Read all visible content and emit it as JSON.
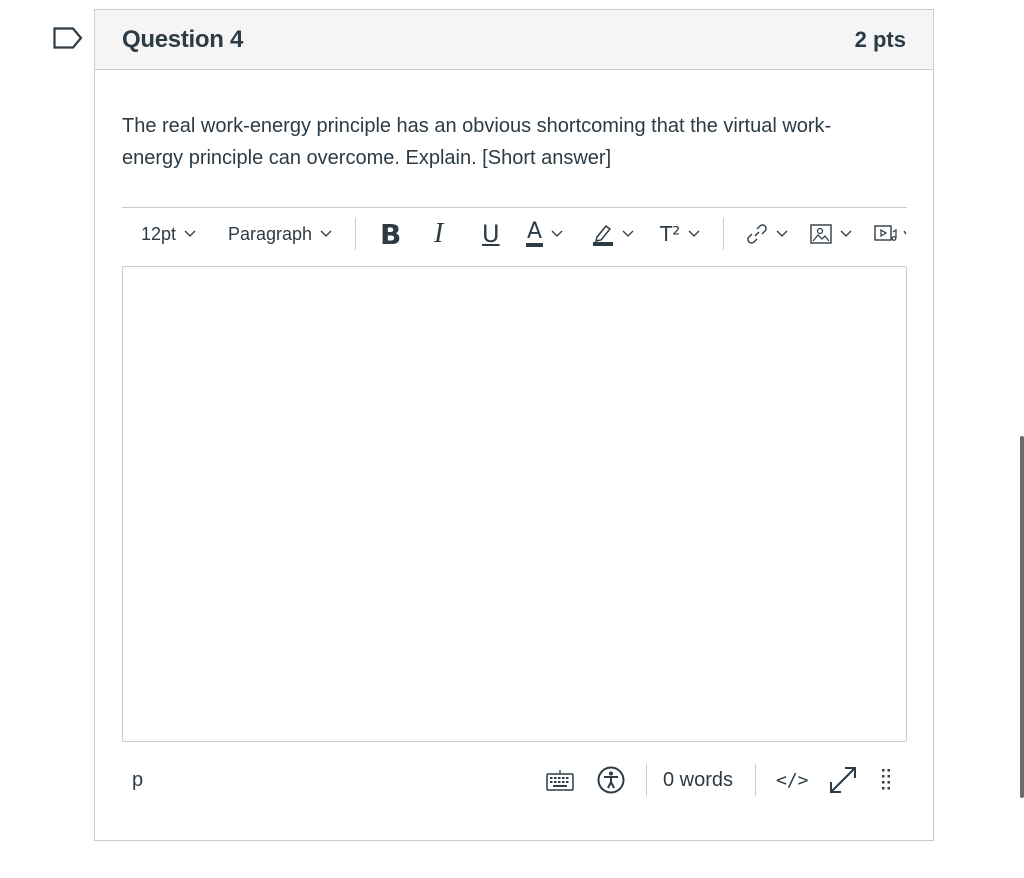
{
  "question": {
    "title": "Question 4",
    "points": "2 pts",
    "text": "The real work-energy principle has an obvious shortcoming that the virtual work-energy principle can overcome. Explain. [Short answer]"
  },
  "toolbar": {
    "font_size": "12pt",
    "block_format": "Paragraph",
    "bold_label": "B",
    "italic_label": "I",
    "underline_label": "U",
    "text_color_label": "A",
    "superscript_label": "T²",
    "icons": [
      "chevron-down-icon",
      "pencil-highlight-icon",
      "link-icon",
      "image-icon",
      "media-icon"
    ]
  },
  "editor": {
    "content": ""
  },
  "statusbar": {
    "path": "p",
    "word_count": "0 words",
    "html_editor_label": "</>",
    "icons": [
      "keyboard-icon",
      "accessibility-icon",
      "fullscreen-icon",
      "resize-grip-icon"
    ]
  },
  "colors": {
    "text": "#2d3b45",
    "border": "#c7cdd1",
    "header_bg": "#f5f5f5"
  }
}
